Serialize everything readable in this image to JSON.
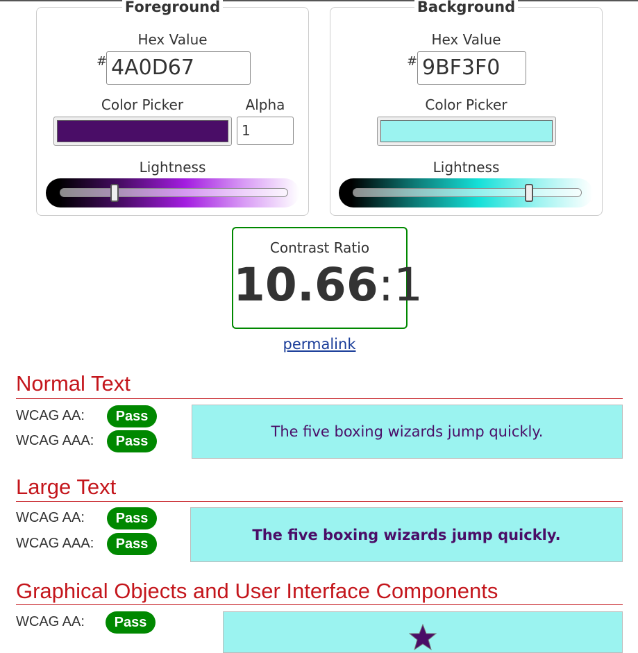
{
  "foreground": {
    "legend": "Foreground",
    "hex_label": "Hex Value",
    "hash": "#",
    "hex": "4A0D67",
    "picker_label": "Color Picker",
    "alpha_label": "Alpha",
    "alpha": "1",
    "lightness_label": "Lightness",
    "lightness_percent": 23,
    "color": "#4A0D67"
  },
  "background": {
    "legend": "Background",
    "hex_label": "Hex Value",
    "hash": "#",
    "hex": "9BF3F0",
    "picker_label": "Color Picker",
    "lightness_label": "Lightness",
    "lightness_percent": 78,
    "color": "#9BF3F0"
  },
  "contrast": {
    "title": "Contrast Ratio",
    "value": "10.66",
    "suffix": ":1"
  },
  "permalink": "permalink",
  "normal": {
    "heading": "Normal Text",
    "aa": "WCAG AA:",
    "aa_result": "Pass",
    "aaa": "WCAG AAA:",
    "aaa_result": "Pass",
    "sample": "The five boxing wizards jump quickly."
  },
  "large": {
    "heading": "Large Text",
    "aa": "WCAG AA:",
    "aa_result": "Pass",
    "aaa": "WCAG AAA:",
    "aaa_result": "Pass",
    "sample": "The five boxing wizards jump quickly."
  },
  "graphical": {
    "heading": "Graphical Objects and User Interface Components",
    "aa": "WCAG AA:",
    "aa_result": "Pass",
    "icon": "star-icon"
  },
  "colors": {
    "pass": "#008000",
    "heading": "#C4161C"
  }
}
